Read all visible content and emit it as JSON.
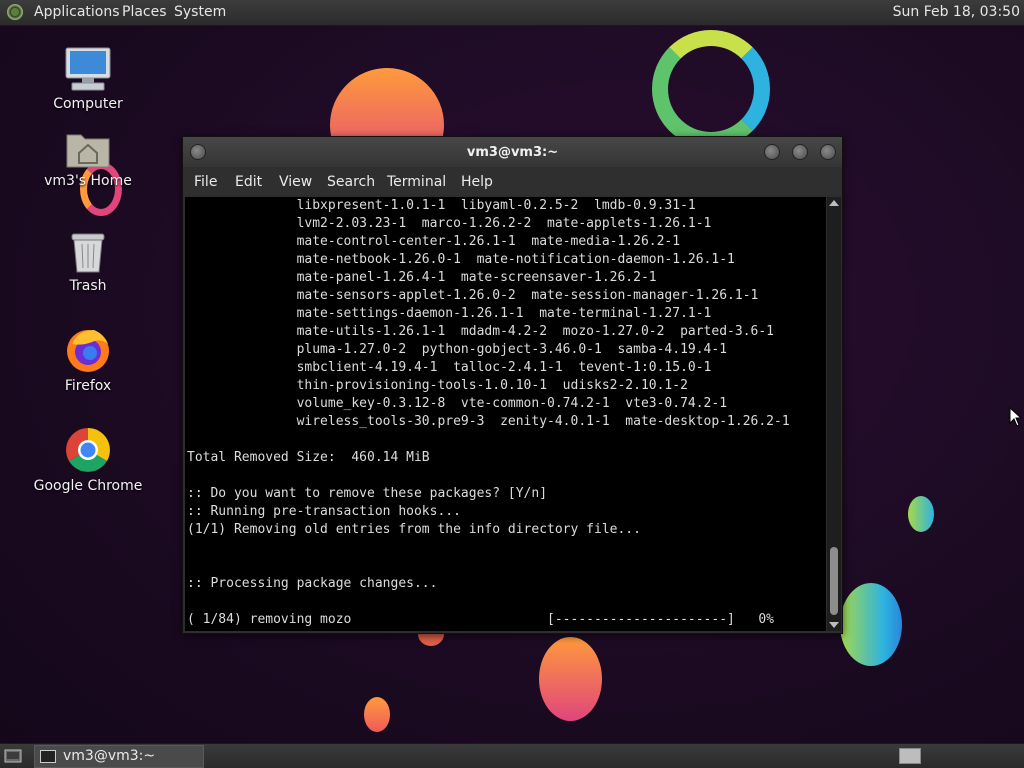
{
  "top_panel": {
    "menus": [
      "Applications",
      "Places",
      "System"
    ],
    "clock": "Sun Feb 18, 03:50"
  },
  "desktop_icons": [
    {
      "label": "Computer"
    },
    {
      "label": "vm3's Home"
    },
    {
      "label": "Trash"
    },
    {
      "label": "Firefox"
    },
    {
      "label": "Google Chrome"
    }
  ],
  "terminal": {
    "title": "vm3@vm3:~",
    "menu": [
      "File",
      "Edit",
      "View",
      "Search",
      "Terminal",
      "Help"
    ],
    "lines": [
      "              libxpresent-1.0.1-1  libyaml-0.2.5-2  lmdb-0.9.31-1",
      "              lvm2-2.03.23-1  marco-1.26.2-2  mate-applets-1.26.1-1",
      "              mate-control-center-1.26.1-1  mate-media-1.26.2-1",
      "              mate-netbook-1.26.0-1  mate-notification-daemon-1.26.1-1",
      "              mate-panel-1.26.4-1  mate-screensaver-1.26.2-1",
      "              mate-sensors-applet-1.26.0-2  mate-session-manager-1.26.1-1",
      "              mate-settings-daemon-1.26.1-1  mate-terminal-1.27.1-1",
      "              mate-utils-1.26.1-1  mdadm-4.2-2  mozo-1.27.0-2  parted-3.6-1",
      "              pluma-1.27.0-2  python-gobject-3.46.0-1  samba-4.19.4-1",
      "              smbclient-4.19.4-1  talloc-2.4.1-1  tevent-1:0.15.0-1",
      "              thin-provisioning-tools-1.0.10-1  udisks2-2.10.1-2",
      "              volume_key-0.3.12-8  vte-common-0.74.2-1  vte3-0.74.2-1",
      "              wireless_tools-30.pre9-3  zenity-4.0.1-1  mate-desktop-1.26.2-1",
      "",
      "Total Removed Size:  460.14 MiB",
      "",
      ":: Do you want to remove these packages? [Y/n]",
      ":: Running pre-transaction hooks...",
      "(1/1) Removing old entries from the info directory file...",
      "",
      "",
      ":: Processing package changes...",
      "",
      "( 1/84) removing mozo                         [----------------------]   0%"
    ]
  },
  "taskbar": {
    "window_label": "vm3@vm3:~"
  }
}
